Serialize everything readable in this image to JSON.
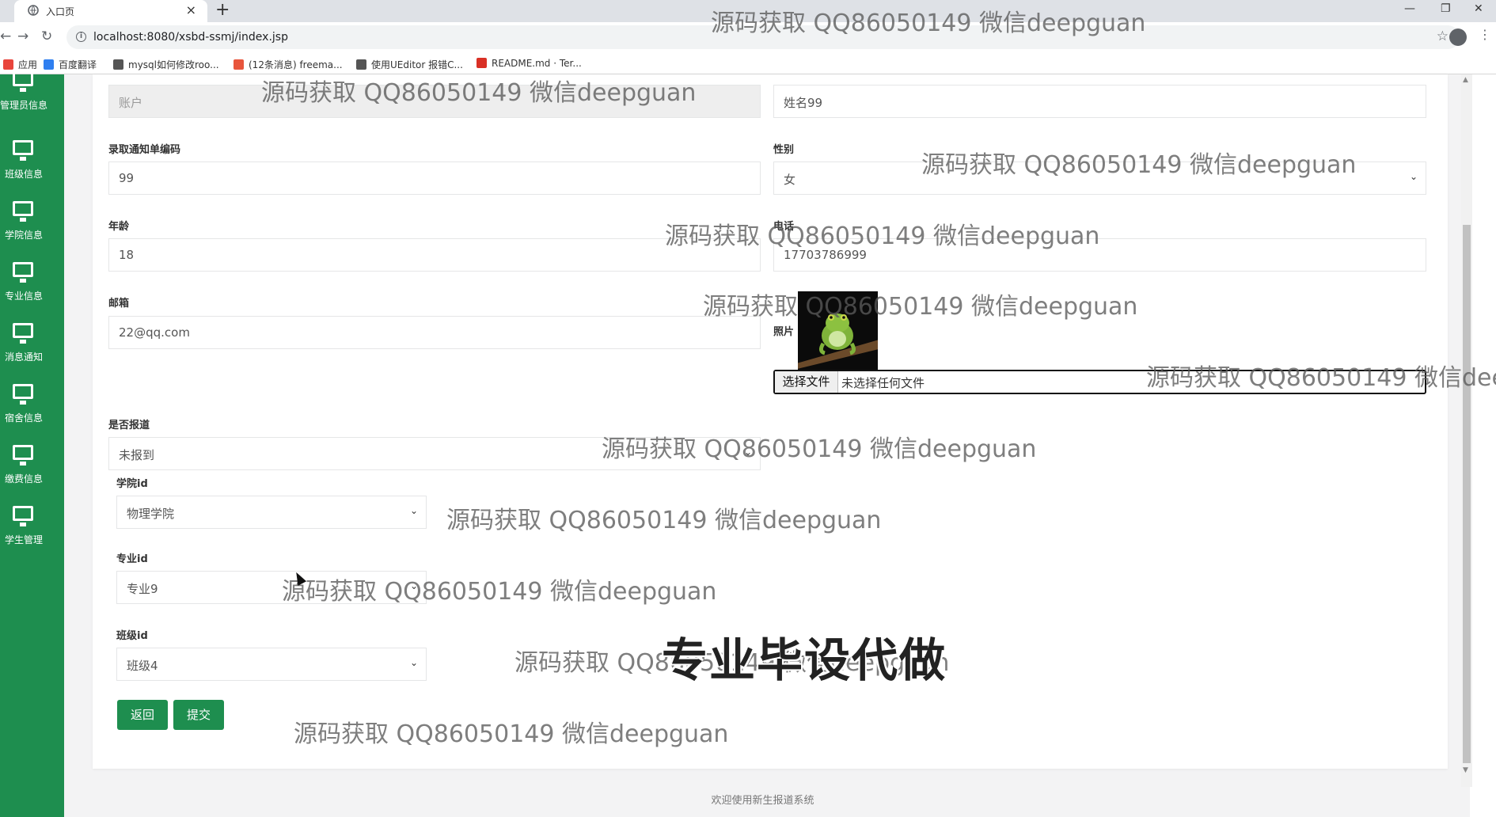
{
  "browser": {
    "tab_title": "入口页",
    "url": "localhost:8080/xsbd-ssmj/index.jsp",
    "bookmarks": [
      {
        "label": "应用",
        "color": "#e8453c"
      },
      {
        "label": "百度翻译",
        "color": "#2f7ff0"
      },
      {
        "label": "mysql如何修改roo...",
        "color": "#555555"
      },
      {
        "label": "(12条消息) freema...",
        "color": "#e8553c"
      },
      {
        "label": "使用UEditor 报错C...",
        "color": "#555555"
      },
      {
        "label": "README.md · Ter...",
        "color": "#d93025"
      }
    ]
  },
  "sidebar": {
    "items": [
      {
        "label": "管理员信息"
      },
      {
        "label": "班级信息"
      },
      {
        "label": "学院信息"
      },
      {
        "label": "专业信息"
      },
      {
        "label": "消息通知"
      },
      {
        "label": "宿舍信息"
      },
      {
        "label": "缴费信息"
      },
      {
        "label": "学生管理"
      }
    ]
  },
  "form": {
    "account_placeholder": "账户",
    "name_value": "姓名99",
    "notice_code_label": "录取通知单编码",
    "notice_code_value": "99",
    "gender_label": "性别",
    "gender_value": "女",
    "age_label": "年龄",
    "age_value": "18",
    "phone_label": "电话",
    "phone_value": "17703786999",
    "email_label": "邮箱",
    "email_value": "22@qq.com",
    "photo_label": "照片",
    "file_button": "选择文件",
    "file_status": "未选择任何文件",
    "reported_label": "是否报道",
    "reported_value": "未报到",
    "college_label": "学院id",
    "college_value": "物理学院",
    "major_label": "专业id",
    "major_value": "专业9",
    "class_label": "班级id",
    "class_value": "班级4",
    "back_button": "返回",
    "submit_button": "提交"
  },
  "footer": "欢迎使用新生报道系统",
  "watermark_text": "源码获取 QQ86050149 微信deepguan",
  "promo_text": "专业毕设代做",
  "colors": {
    "sidebar": "#1e8e4f",
    "button": "#1e8e4f"
  }
}
